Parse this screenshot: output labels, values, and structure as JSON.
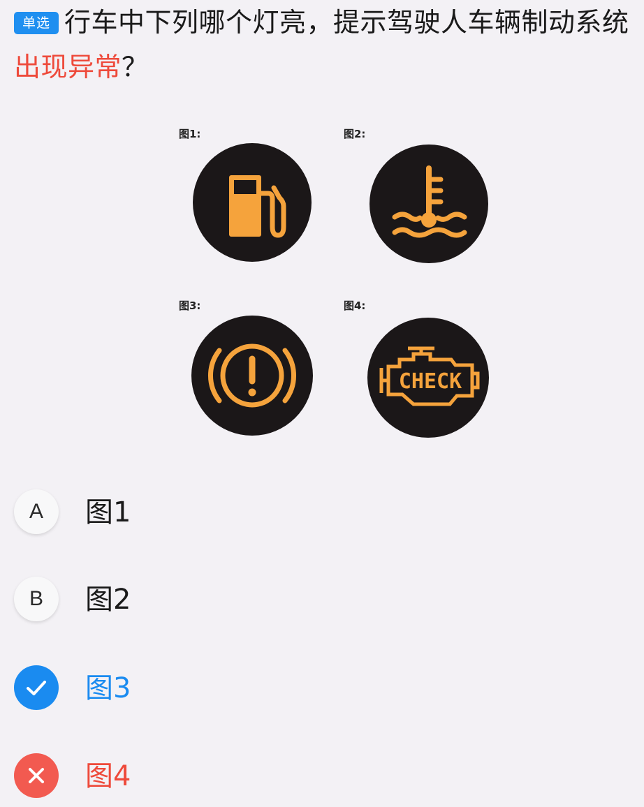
{
  "question": {
    "type_badge": "单选",
    "text_before": "行车中下列哪个灯亮，提示驾驶人车辆制动系统",
    "text_highlight": "出现异常",
    "text_after": "？"
  },
  "figure": {
    "labels": [
      "图1:",
      "图2:",
      "图3:",
      "图4:"
    ],
    "lamps": [
      {
        "icon": "fuel-gauge-icon"
      },
      {
        "icon": "coolant-temperature-icon"
      },
      {
        "icon": "brake-warning-icon"
      },
      {
        "icon": "check-engine-icon",
        "text": "CHECK"
      }
    ],
    "lamp_color": "#f5a33c"
  },
  "options": [
    {
      "key": "A",
      "label": "图1",
      "state": "normal"
    },
    {
      "key": "B",
      "label": "图2",
      "state": "normal"
    },
    {
      "key": "C",
      "label": "图3",
      "state": "correct"
    },
    {
      "key": "D",
      "label": "图4",
      "state": "wrong"
    }
  ],
  "colors": {
    "correct": "#1a8bf0",
    "wrong": "#ee4a3b",
    "badge": "#1f8ff0"
  }
}
